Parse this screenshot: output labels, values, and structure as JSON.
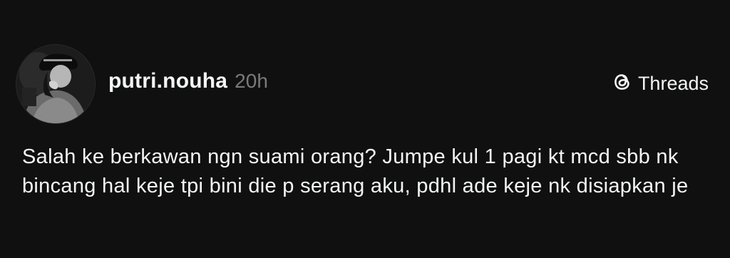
{
  "post": {
    "author": {
      "username": "putri.nouha",
      "avatar": "profile-photo"
    },
    "timestamp": "20h",
    "brand": {
      "icon": "threads-logo-icon",
      "label": "Threads"
    },
    "text": "Salah ke berkawan ngn suami orang? Jumpe kul 1 pagi kt mcd sbb nk bincang hal keje tpi bini die p serang aku, pdhl ade keje nk disiapkan je"
  },
  "colors": {
    "background": "#101010",
    "text_primary": "#f3f5f7",
    "text_secondary": "#7a7a7a"
  }
}
